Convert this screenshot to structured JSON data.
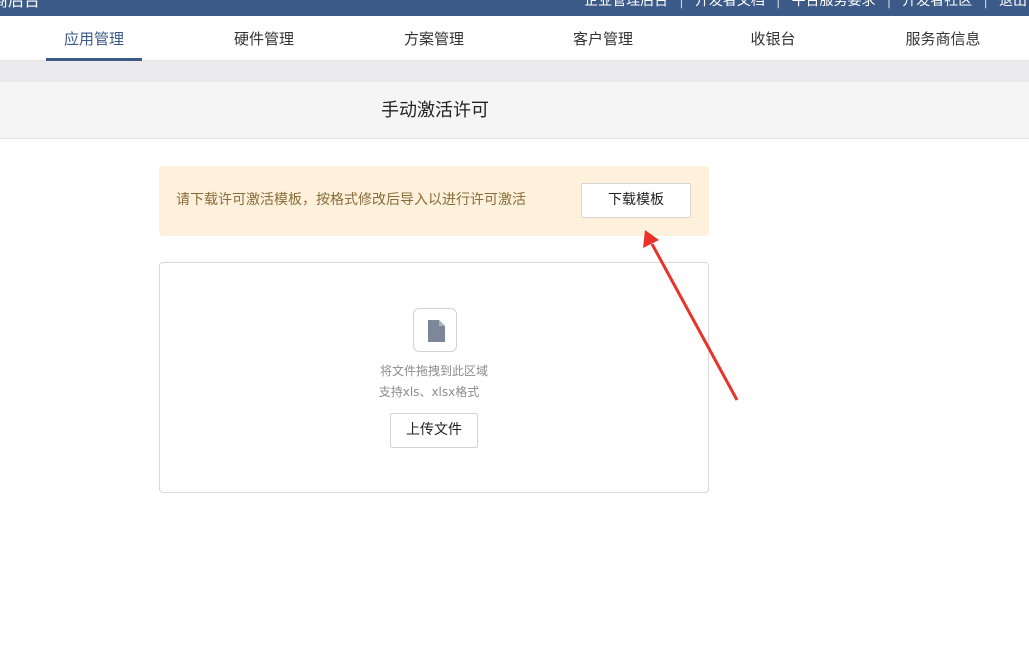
{
  "topbar": {
    "brand": "商后台",
    "links": [
      "企业管理后台",
      "开发者文档",
      "平台服务要求",
      "开发者社区",
      "退出"
    ],
    "separator": "|"
  },
  "nav": {
    "tabs": [
      {
        "label": "应用管理",
        "active": true
      },
      {
        "label": "硬件管理",
        "active": false
      },
      {
        "label": "方案管理",
        "active": false
      },
      {
        "label": "客户管理",
        "active": false
      },
      {
        "label": "收银台",
        "active": false
      },
      {
        "label": "服务商信息",
        "active": false
      }
    ]
  },
  "page": {
    "title": "手动激活许可"
  },
  "notice": {
    "message": "请下载许可激活模板，按格式修改后导入以进行许可激活",
    "button_label": "下载模板"
  },
  "upload": {
    "icon": "file-icon",
    "hint_drag": "将文件拖拽到此区域",
    "hint_formats": "支持xls、xlsx格式",
    "button_label": "上传文件"
  },
  "colors": {
    "brand": "#3b5a87",
    "notice_bg": "#fdf1db",
    "notice_text": "#8a6b3a",
    "annotation_arrow": "#e8322a"
  }
}
